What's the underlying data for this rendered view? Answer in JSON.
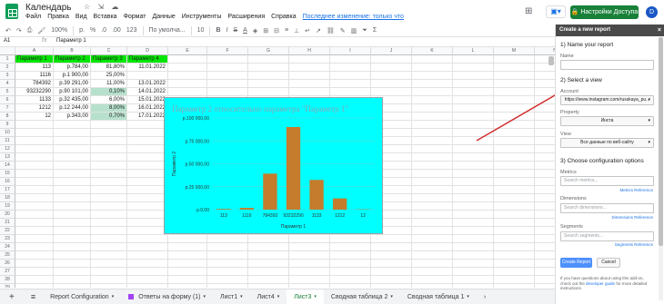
{
  "doc": {
    "title": "Календарь",
    "title_icons": "☆ ⇲ ☁",
    "menu": [
      "Файл",
      "Правка",
      "Вид",
      "Вставка",
      "Формат",
      "Данные",
      "Инструменты",
      "Расширения",
      "Справка"
    ],
    "last_edit": "Последнее изменение: только что",
    "share_label": "Настройки Доступа",
    "avatar_letter": "D"
  },
  "toolbar": {
    "zoom": "100%",
    "currency": "р.",
    "percent": "%",
    "dec_less": ".0",
    "dec_more": ".00",
    "more_formats": "123",
    "font": "По умолча...",
    "font_size": "10"
  },
  "formula_bar": {
    "cell_ref": "A1",
    "fx": "fx",
    "value": "Параметр 1"
  },
  "grid": {
    "columns": [
      "A",
      "B",
      "C",
      "D",
      "E",
      "F",
      "G",
      "H",
      "I",
      "J",
      "K",
      "L",
      "M",
      "N"
    ],
    "headers": [
      "Параметр 1",
      "Параметр 2",
      "Параметр 3",
      "Параметр 4"
    ],
    "rows": [
      {
        "a": "113",
        "b": "р.784,00",
        "c": "81,80%",
        "d": "11.01.2022"
      },
      {
        "a": "1116",
        "b": "р.1 900,00",
        "c": "25,00%",
        "d": ""
      },
      {
        "a": "784392",
        "b": "р.39 291,00",
        "c": "11,00%",
        "d": "13.01.2022"
      },
      {
        "a": "93232290",
        "b": "р.90 101,00",
        "c": "0,10%",
        "d": "14.01.2022"
      },
      {
        "a": "1133",
        "b": "р.32 435,00",
        "c": "6,00%",
        "d": "15.01.2022"
      },
      {
        "a": "1212",
        "b": "р.12 244,00",
        "c": "8,00%",
        "d": "16.01.2022"
      },
      {
        "a": "12",
        "b": "р.343,00",
        "c": "0,70%",
        "d": "17.01.2022"
      }
    ],
    "row_numbers": [
      "1",
      "2",
      "3",
      "4",
      "5",
      "6",
      "7",
      "8",
      "9",
      "10",
      "11",
      "12",
      "13",
      "14",
      "15",
      "16",
      "17",
      "18",
      "19",
      "20",
      "21",
      "22",
      "23",
      "24",
      "25",
      "26",
      "27",
      "28",
      "29"
    ]
  },
  "tabs": {
    "add": "+",
    "menu": "≡",
    "items": [
      "Report Configuration",
      "Ответы на форму (1)",
      "Лист1",
      "Лист4",
      "Лист3",
      "Сводная таблица 2",
      "Сводная таблица 1"
    ],
    "active_index": 4,
    "nav": "›"
  },
  "sidebar": {
    "header": "Create a new report",
    "close": "×",
    "s1": "1) Name your report",
    "name_label": "Name",
    "name_value": "",
    "s2": "2) Select a view",
    "account_label": "Account",
    "account_value": "https://www.instagram.com/russkaya_pu...",
    "property_label": "Property",
    "property_value": "Инста",
    "view_label": "View",
    "view_value": "Все данные по веб-сайту",
    "s3": "3) Choose configuration options",
    "metrics_label": "Metrics",
    "metrics_placeholder": "Search metrics...",
    "metrics_ref": "Metrics Reference",
    "dimensions_label": "Dimensions",
    "dimensions_placeholder": "Search dimensions...",
    "dimensions_ref": "Dimensions Reference",
    "segments_label": "Segments",
    "segments_placeholder": "Search segments...",
    "segments_ref": "Segments Reference",
    "create": "Create Report",
    "cancel": "Cancel",
    "help_pre": "If you have questions about using this add-on, check out the ",
    "help_link": "developer guide",
    "help_post": " for more detailed instructions."
  },
  "chart_data": {
    "type": "bar",
    "title": "Параметр 2 относительно параметра \"Параметр 1\"",
    "xlabel": "Параметр 1",
    "ylabel": "Параметр 2",
    "categories": [
      "113",
      "1116",
      "784392",
      "93232290",
      "1133",
      "1212",
      "12"
    ],
    "values": [
      784,
      1900,
      39291,
      90101,
      32435,
      12244,
      343
    ],
    "ylim": [
      0,
      100000
    ],
    "yticks": [
      "р.0,00",
      "р.25 000,00",
      "р.50 000,00",
      "р.75 000,00",
      "р.100 000,00"
    ],
    "tick_values": [
      0,
      25000,
      50000,
      75000,
      100000
    ],
    "bar_color": "#c57c2c",
    "background": "#00ffff"
  }
}
